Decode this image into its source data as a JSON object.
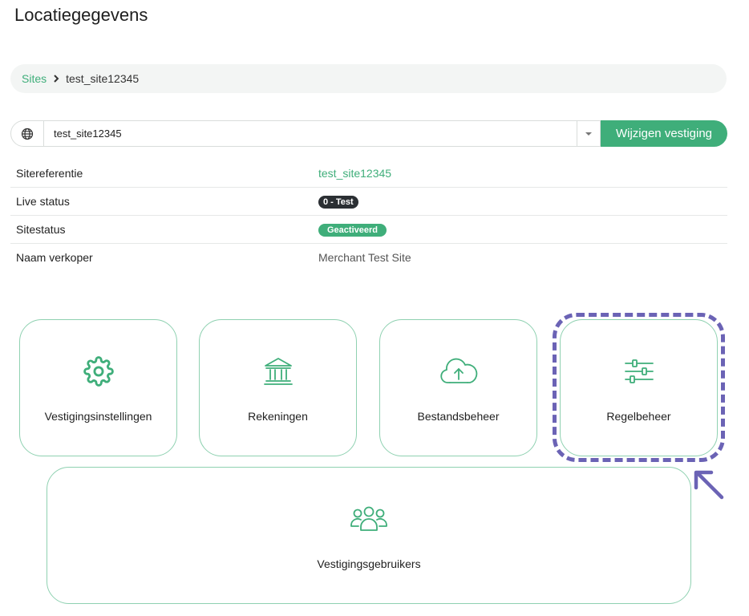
{
  "page": {
    "title": "Locatiegegevens"
  },
  "breadcrumb": {
    "root": "Sites",
    "current": "test_site12345"
  },
  "site_selector": {
    "value": "test_site12345",
    "button_label": "Wijzigen vestiging"
  },
  "details": [
    {
      "label": "Sitereferentie",
      "value": "test_site12345",
      "kind": "link"
    },
    {
      "label": "Live status",
      "value": "0 - Test",
      "kind": "badge-dark"
    },
    {
      "label": "Sitestatus",
      "value": "Geactiveerd",
      "kind": "badge-green"
    },
    {
      "label": "Naam verkoper",
      "value": "Merchant Test Site",
      "kind": "text"
    }
  ],
  "tiles": [
    {
      "label": "Vestigingsinstellingen",
      "icon": "gear-icon"
    },
    {
      "label": "Rekeningen",
      "icon": "bank-icon"
    },
    {
      "label": "Bestandsbeheer",
      "icon": "cloud-upload-icon"
    },
    {
      "label": "Regelbeheer",
      "icon": "sliders-icon"
    },
    {
      "label": "Vestigingsgebruikers",
      "icon": "users-icon"
    }
  ],
  "colors": {
    "accent": "#3fae7a",
    "highlight": "#6b63b5",
    "badge_dark": "#2b2f33"
  }
}
